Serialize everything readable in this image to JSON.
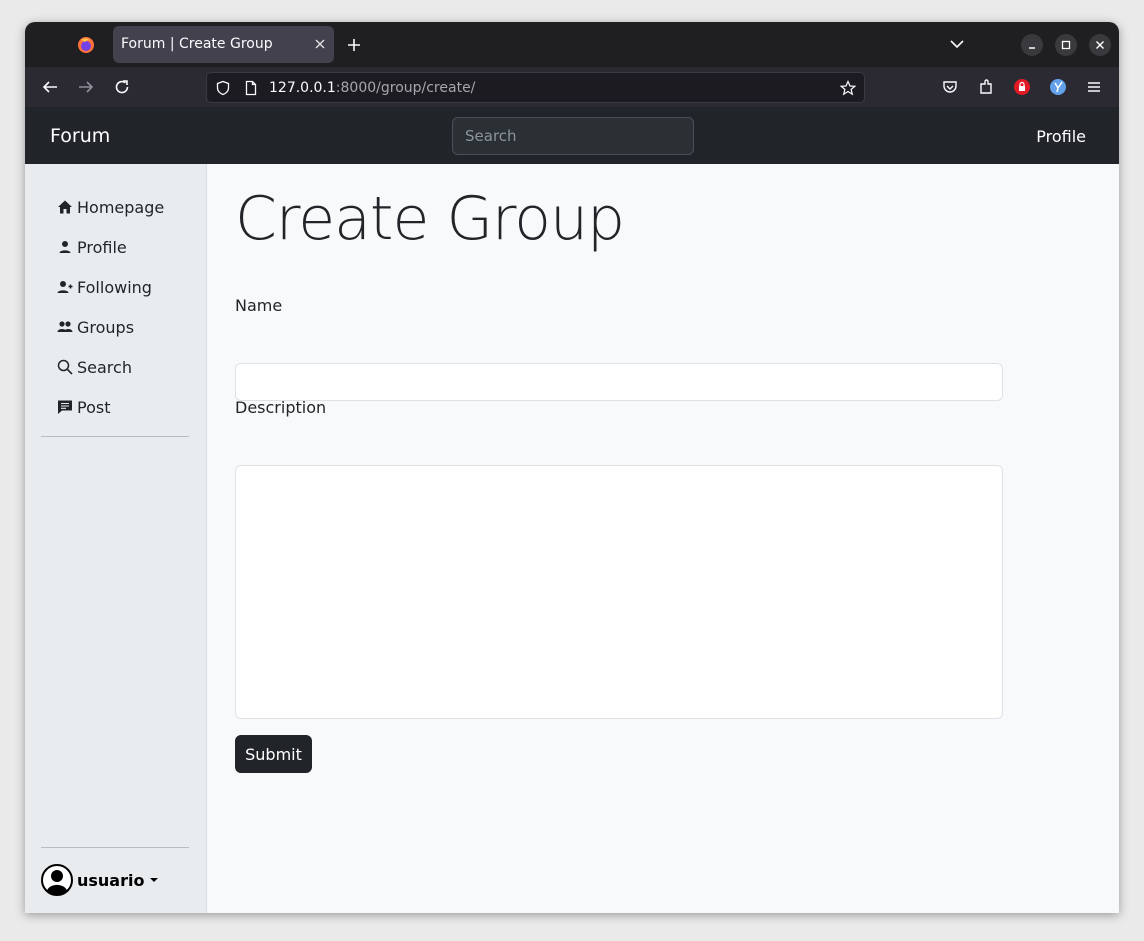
{
  "browser": {
    "tab_title": "Forum | Create Group",
    "url_host": "127.0.0.1",
    "url_path": ":8000/group/create/"
  },
  "navbar": {
    "brand": "Forum",
    "search_placeholder": "Search",
    "profile_label": "Profile"
  },
  "sidebar": {
    "items": [
      {
        "label": "Homepage",
        "icon": "house-icon"
      },
      {
        "label": "Profile",
        "icon": "person-icon"
      },
      {
        "label": "Following",
        "icon": "person-plus-icon"
      },
      {
        "label": "Groups",
        "icon": "people-icon"
      },
      {
        "label": "Search",
        "icon": "search-icon"
      },
      {
        "label": "Post",
        "icon": "chat-icon"
      }
    ],
    "user": "usuario"
  },
  "main": {
    "title": "Create Group",
    "name_label": "Name",
    "description_label": "Description",
    "submit_label": "Submit"
  },
  "colors": {
    "navbar_bg": "#212529",
    "sidebar_bg": "#e9ecef",
    "button_bg": "#212529"
  }
}
